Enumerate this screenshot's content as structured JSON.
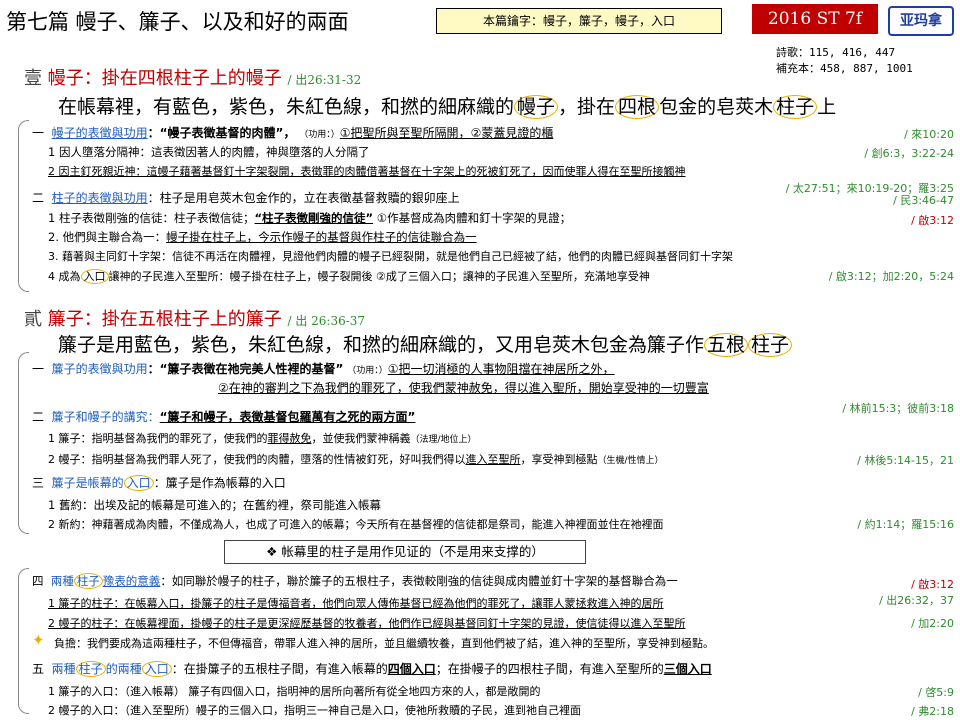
{
  "header": {
    "title": "第七篇  幔子、簾子、以及和好的兩面",
    "keywords": "本篇鑰字：幔子，簾子，幔子，入口",
    "code": "2016 ST 7f",
    "stamp": "亚玛拿",
    "hymns": "詩歌：115, 416, 447",
    "supplement": "補充本：458, 887, 1001"
  },
  "s1": {
    "num": "壹",
    "title": "幔子：掛在四根柱子上的幔子",
    "title_ref": "/ 出26:31-32",
    "intro_a": "在帳幕裡，有藍色，紫色，朱紅色線，和撚的細麻織的",
    "intro_w1": "幔子",
    "intro_b": "，掛在",
    "intro_w2": "四根",
    "intro_c": "包金的皂莢木",
    "intro_w3": "柱子",
    "intro_d": "上",
    "a_num": "一",
    "a_head": "幔子的表徵與功用",
    "a_q": "：“幔子表徵基督的肉體”，",
    "a_func": "（功用：）",
    "a_f1": "①把聖所與至聖所隔開，",
    "a_f2": "②蒙蓋見證的櫃",
    "a_ref": "/ 來10:20",
    "a1": "1   因人墮落分隔神：這表徵因著人的肉體，神與墮落的人分隔了",
    "a1_ref": "/ 創6:3，3:22-24",
    "a2": "2   因主釘死親近神：這幔子藉著基督釘十字架裂開，表徵罪的肉體借著基督在十字架上的死被釘死了，因而使罪人得在至聖所接觸神",
    "a2_ref": "/ 太27:51；來10:19-20；羅3:25",
    "b_num": "二",
    "b_head": "柱子的表徵與功用",
    "b_text": "：柱子是用皂莢木包金作的，立在表徵基督救贖的銀卯座上",
    "b_ref": "/ 民3:46-47",
    "b1a": "1   柱子表徵剛強的信徒：柱子表徵信徒；",
    "b1b": "“柱子表徵剛強的信徒”",
    "b1c": "  ①作基督成為肉體和釘十字架的見證；",
    "b1_ref": "/ 啟3:12",
    "b2a": "2.  他們與主聯合為一：",
    "b2b": "幔子掛在柱子上，今示作幔子的基督與作柱子的信徒聯合為一",
    "b3": "3.  藉著與主同釘十字架：信徒不再活在肉體裡，見證他們肉體的幔子已經裂開，就是他們自己已經被了結，他們的肉體已經與基督同釘十字架",
    "b4a": "4   成為",
    "b4w": "入口",
    "b4b": "讓神的子民進入至聖所：幔子掛在柱子上，幔子裂開後  ②成了三個入口；讓神的子民進入至聖所，充滿地享受神",
    "b4_ref": "/ 啟3:12；加2:20，5:24"
  },
  "s2": {
    "num": "貳",
    "title": "簾子：掛在五根柱子上的簾子",
    "title_ref": "/ 出 26:36-37",
    "intro_a": "簾子是用藍色，紫色，朱紅色線，和撚的細麻織的，又用皂莢木包金為簾子作",
    "intro_w1": "五根",
    "intro_w2": "柱子",
    "a_num": "一",
    "a_head": "簾子的表徵與功用",
    "a_q": "：“簾子表徵在祂完美人性裡的基督”",
    "a_func": "（功用：）",
    "a_f1": "①把一切消極的人事物阻擋在神居所之外，",
    "a_f2": "②在神的審判之下為我們的罪死了，使我們蒙神赦免，得以進入聖所，開始享受神的一切豐富",
    "a_ref": "/ 林前15:3；彼前3:18",
    "b_num": "二",
    "b_head": "簾子和幔子的講究：",
    "b_q": "“簾子和幔子，表徵基督包羅萬有之死的兩方面”",
    "b1a": "1   簾子：指明基督為我們的罪死了，使我們的",
    "b1b": "罪得赦免",
    "b1c": "，並使我們蒙神稱義",
    "b1d": "（法理/地位上）",
    "b2a": "2   幔子：指明基督為我們罪人死了，使我們的肉體，墮落的性情被釘死，好叫我們得以",
    "b2b": "進入至聖所",
    "b2c": "，享受神到極點",
    "b2d": "（生機/性情上）",
    "b2_ref": "/ 林後5:14-15，21",
    "c_num": "三",
    "c_head": "簾子是帳幕的",
    "c_w": "入口",
    "c_text": "：簾子是作為帳幕的入口",
    "c1": "1   舊約：出埃及記的帳幕是可進入的；在舊約裡，祭司能進入帳幕",
    "c2": "2   新約：神藉著成為肉體，不僅成為人，也成了可進入的帳幕；今天所有在基督裡的信徒都是祭司，能進入神裡面並住在祂裡面",
    "c2_ref": "/ 約1:14；羅15:16",
    "note": "❖ 帐幕里的柱子是用作见证的（不是用来支撑的）",
    "d_num": "四",
    "d_head_a": "兩種",
    "d_w": "柱子",
    "d_head_b": "豫表的意義",
    "d_text": "：如同聯於幔子的柱子，聯於簾子的五根柱子，表徵較剛強的信徒與成肉體並釘十字架的基督聯合為一",
    "d_ref": "/ 啟3:12",
    "d1": "1   簾子的柱子：在帳幕入口，掛簾子的柱子是傳福音者，他們向眾人傳佈基督已經為他們的罪死了，讓罪人蒙拯救進入神的居所",
    "d1_ref": "/ 出26:32，37",
    "d2": "2   幔子的柱子：在帳幕裡面，掛幔子的柱子是更深經歷基督的牧養者，他們作已經與基督同釘十字架的見證，使信徒得以進入至聖所",
    "d2_ref": "/ 加2:20",
    "d3": "負擔：我們要成為這兩種柱子，不但傳福音，帶罪人進入神的居所，並且繼續牧養，直到他們被了結，進入神的至聖所，享受神到極點。",
    "e_num": "五",
    "e_head_a": "兩種",
    "e_w1": "柱子",
    "e_head_b": "的兩種",
    "e_w2": "入口",
    "e_text_a": "：在掛簾子的五根柱子間，有進入帳幕的",
    "e_text_b": "四個入口",
    "e_text_c": "；在掛幔子的四根柱子間，有進入至聖所的",
    "e_text_d": "三個入口",
    "e1": "1   簾子的入口：（進入帳幕）   簾子有四個入口，指明神的居所向著所有從全地四方來的人，都是敞開的",
    "e1_ref": "/ 啓5:9",
    "e2": "2   幔子的入口：（進入至聖所）幔子的三個入口，指明三一神自己是入口，使祂所救贖的子民，進到祂自己裡面",
    "e2_ref": "/ 弗2:18"
  }
}
